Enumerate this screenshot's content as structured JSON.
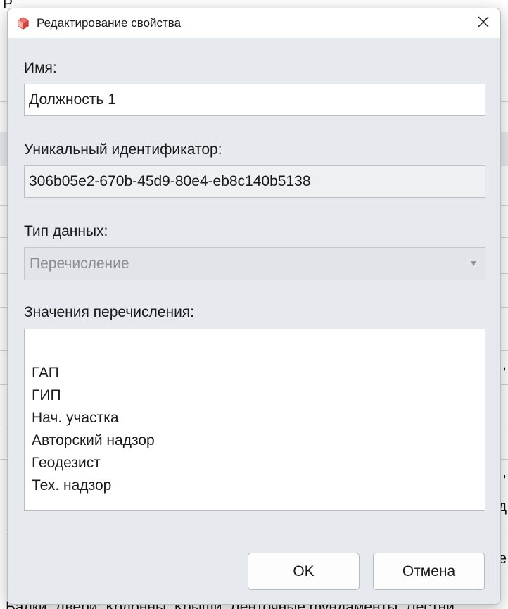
{
  "background": {
    "bottom_text": "Балки, Двери, Колонны, Крыши, Ленточные фундаменты, Лестни",
    "top_left_text": "Р",
    "right_frag_1": ",",
    "right_frag_2": ",",
    "right_frag_3": "д",
    "right_frag_4": "е"
  },
  "dialog": {
    "title": "Редактирование свойства",
    "name_label": "Имя:",
    "name_value": "Должность 1",
    "uid_label": "Уникальный идентификатор:",
    "uid_value": "306b05e2-670b-45d9-80e4-eb8c140b5138",
    "type_label": "Тип данных:",
    "type_value": "Перечисление",
    "enum_label": "Значения перечисления:",
    "enum_values": [
      "ГАП",
      "ГИП",
      "Нач. участка",
      "Авторский надзор",
      "Геодезист",
      "Тех. надзор"
    ],
    "ok_label": "OK",
    "cancel_label": "Отмена"
  },
  "icons": {
    "app": "cube-icon",
    "close": "close-icon",
    "dropdown": "chevron-down-icon"
  },
  "colors": {
    "dialog_bg": "#e6e9ed",
    "titlebar_bg": "#ffffff",
    "accent_icon": "#d9534f"
  }
}
